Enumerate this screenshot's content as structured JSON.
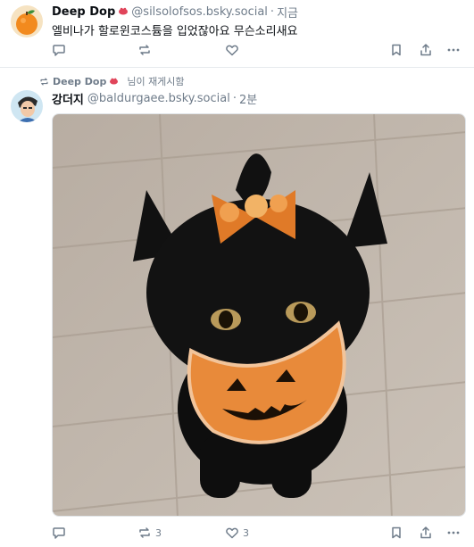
{
  "post1": {
    "author_name": "Deep Dop",
    "handle": "@silsolofsos.bsky.social",
    "time": "지금",
    "text": "엘비나가 할로윈코스튬을 입었잖아요 무슨소리새요",
    "avatar_icon": "orange-fruit-avatar",
    "actions": {
      "reply_count": "",
      "repost_count": "",
      "like_count": ""
    }
  },
  "post2": {
    "repost": {
      "reposter": "Deep Dop",
      "suffix": "님이 재게시함"
    },
    "author_name": "강더지",
    "handle": "@baldurgaee.bsky.social",
    "time": "2분",
    "media_icon": "black-cat-halloween-photo",
    "actions": {
      "reply_count": "",
      "repost_count": "3",
      "like_count": "3"
    }
  },
  "colors": {
    "muted": "#6f7c8a",
    "text": "#0b0f14",
    "divider": "#e6eaee",
    "floor": "#bfb4a8",
    "bib": "#e88a3a"
  }
}
